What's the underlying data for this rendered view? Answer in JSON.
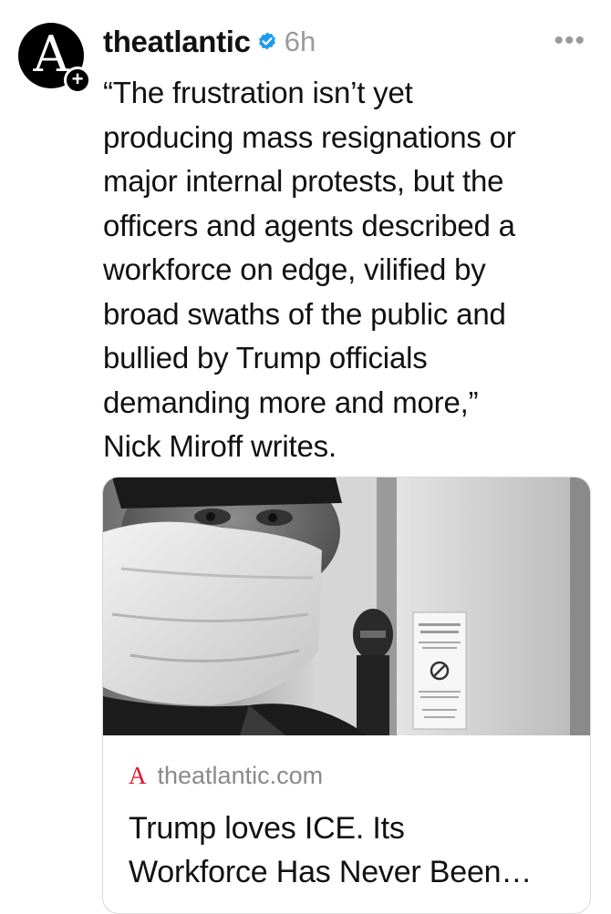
{
  "post": {
    "avatar_letter": "A",
    "follow_badge": "+",
    "username": "theatlantic",
    "verified": true,
    "time": "6h",
    "more_label": "•••",
    "text": "“The frustration isn’t yet\nproducing mass resignations or\nmajor internal protests, but the\nofficers and agents described a\nworkforce on edge, vilified by\nbroad swaths of the public and\nbullied by Trump officials\ndemanding more and more,”\nNick Miroff writes."
  },
  "link_card": {
    "logo_letter": "A",
    "domain": "theatlantic.com",
    "title": "Trump loves ICE. Its\nWorkforce Has Never Been…"
  },
  "colors": {
    "verified_blue": "#1d9bf0",
    "atlantic_red": "#e0112b",
    "muted_gray": "#9a9a9a"
  }
}
